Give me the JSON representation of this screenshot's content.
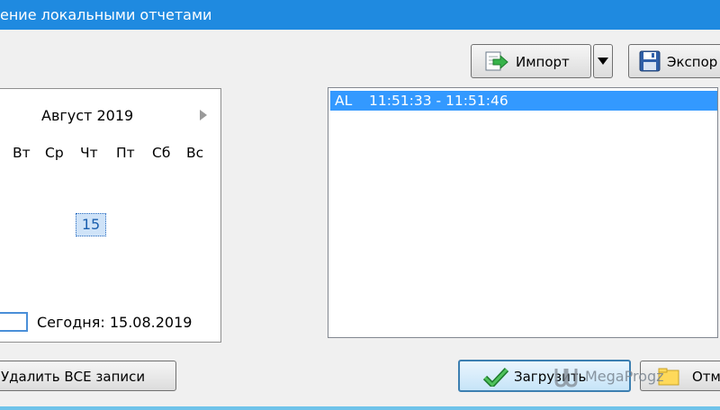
{
  "window": {
    "title": "ение локальными отчетами"
  },
  "toolbar": {
    "import_label": "Импорт",
    "export_label": "Экспор"
  },
  "calendar": {
    "month_label": "Август 2019",
    "weekdays": [
      "Вт",
      "Ср",
      "Чт",
      "Пт",
      "Сб",
      "Вс"
    ],
    "selected_day": "15",
    "today_label": "Сегодня: 15.08.2019"
  },
  "records": {
    "items": [
      {
        "type": "AL",
        "time_range": "11:51:33 - 11:51:46"
      }
    ]
  },
  "actions": {
    "delete_all_label": "Удалить ВСЕ записи",
    "load_label": "Загрузить",
    "cancel_label": "Отм"
  },
  "watermark": {
    "text": "MegaProgz"
  },
  "colors": {
    "titlebar": "#1f8ae0",
    "selection": "#3399ff",
    "accent_border": "#3c7fb1"
  },
  "icons": {
    "import": "import-arrow-icon",
    "export": "floppy-disk-icon",
    "load": "checkmark-icon",
    "cancel": "folder-icon",
    "dropdown": "triangle-down-icon",
    "next_month": "triangle-right-icon"
  }
}
